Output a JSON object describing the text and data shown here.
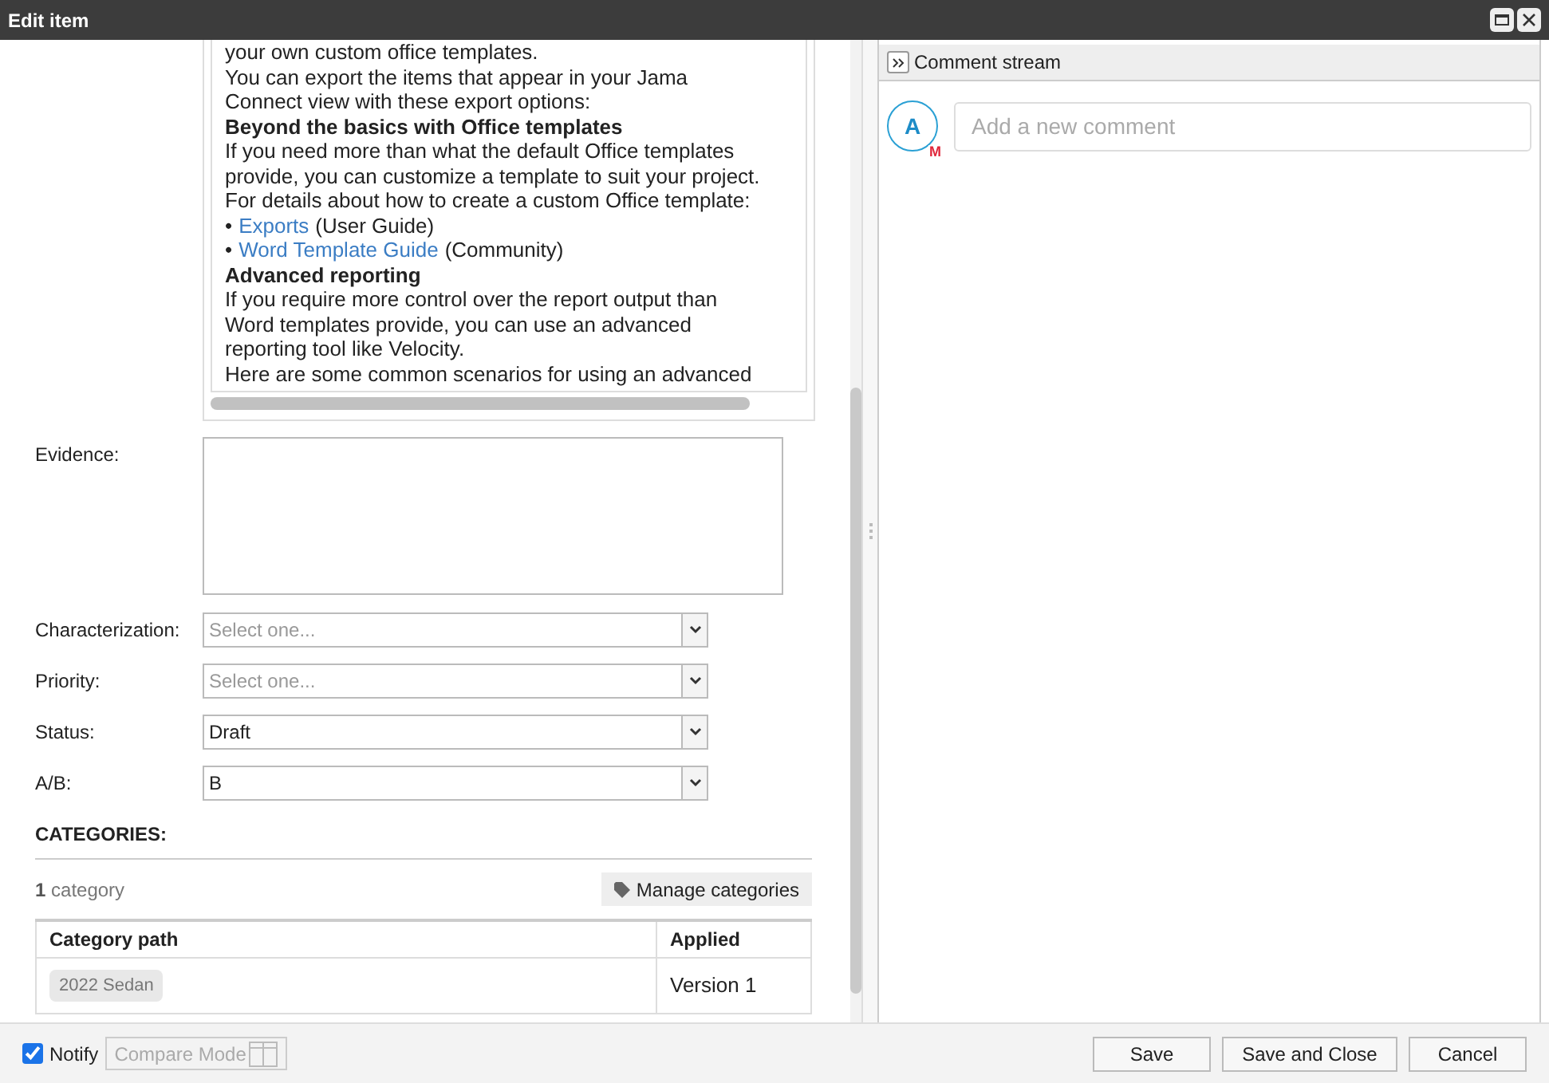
{
  "window": {
    "title": "Edit item"
  },
  "description": {
    "blocks": [
      {
        "kind": "text",
        "text": "your own custom office templates."
      },
      {
        "kind": "text",
        "text": "You can export the items that appear in your Jama"
      },
      {
        "kind": "text",
        "text": "Connect view with these export options:"
      },
      {
        "kind": "heading",
        "text": "Beyond the basics with Office templates"
      },
      {
        "kind": "text",
        "text": "If you need more than what the default Office templates"
      },
      {
        "kind": "text",
        "text": "provide, you can customize a template to suit your project."
      },
      {
        "kind": "text",
        "text": "For details about how to create a custom Office template:"
      },
      {
        "kind": "link_item",
        "bullet": "•",
        "link": "Exports",
        "suffix": "(User Guide)"
      },
      {
        "kind": "link_item",
        "bullet": "•",
        "link": "Word Template Guide",
        "suffix": "(Community)"
      },
      {
        "kind": "heading",
        "text": "Advanced reporting"
      },
      {
        "kind": "text",
        "text": "If you require more control over the report output than"
      },
      {
        "kind": "text",
        "text": "Word templates provide, you can use an advanced"
      },
      {
        "kind": "text",
        "text": "reporting tool like Velocity."
      },
      {
        "kind": "text",
        "text": "Here are some common scenarios for using an advanced"
      }
    ]
  },
  "evidence": {
    "label": "Evidence:"
  },
  "fields": [
    {
      "label": "Characterization:",
      "placeholder": "Select one..."
    },
    {
      "label": "Priority:",
      "placeholder": "Select one..."
    },
    {
      "label": "Status:",
      "value": "Draft"
    },
    {
      "label": "A/B:",
      "value": "B"
    }
  ],
  "categories": {
    "title": "CATEGORIES:",
    "count": "1",
    "count_label": "category",
    "manage_button": "Manage categories",
    "columns": [
      "Category path",
      "Applied"
    ],
    "rows": [
      {
        "path": "2022 Sedan",
        "applied": "Version 1"
      }
    ]
  },
  "comments": {
    "title": "Comment stream",
    "avatar_letter": "A",
    "avatar_badge": "M",
    "placeholder": "Add a new comment"
  },
  "footer": {
    "notify": {
      "label": "Notify",
      "checked": true
    },
    "compare_mode": {
      "label": "Compare Mode",
      "disabled": true
    },
    "buttons": [
      "Save",
      "Save and Close",
      "Cancel"
    ]
  }
}
